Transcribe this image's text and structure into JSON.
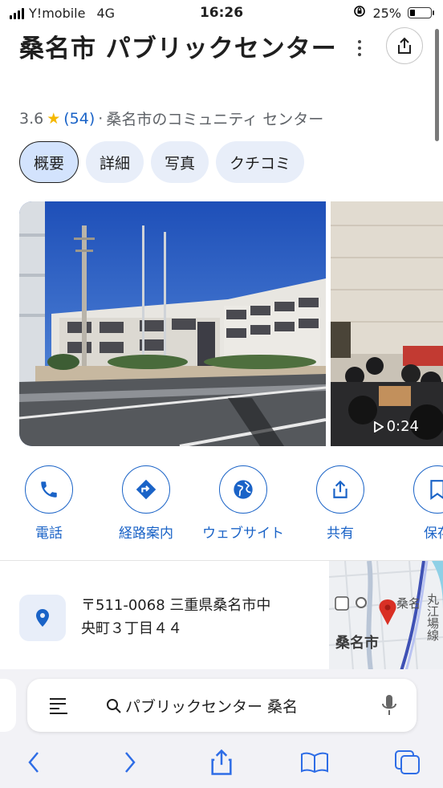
{
  "status_bar": {
    "carrier": "Y!mobile",
    "network": "4G",
    "time": "16:26",
    "battery": "25%",
    "battery_level": 0.25
  },
  "place": {
    "name": "桑名市 パブリックセンター",
    "rating": "3.6",
    "reviews": "(54)",
    "separator": "·",
    "category": "桑名市のコミュニティ センター"
  },
  "tabs": [
    {
      "label": "概要",
      "active": true
    },
    {
      "label": "詳細",
      "active": false
    },
    {
      "label": "写真",
      "active": false
    },
    {
      "label": "クチコミ",
      "active": false
    }
  ],
  "video": {
    "duration": "0:24"
  },
  "actions": [
    {
      "label": "電話",
      "icon": "phone-icon"
    },
    {
      "label": "経路案内",
      "icon": "directions-icon"
    },
    {
      "label": "ウェブサイト",
      "icon": "globe-icon"
    },
    {
      "label": "共有",
      "icon": "share-icon"
    },
    {
      "label": "保存",
      "icon": "bookmark-icon"
    }
  ],
  "address": {
    "line1": "〒511-0068 三重県桑名市中",
    "line2": "央町３丁目４４"
  },
  "map": {
    "city_label": "桑名市",
    "station_label": "桑名",
    "road_label": "丸江場線"
  },
  "browser": {
    "search_query": "パブリックセンター 桑名"
  },
  "colors": {
    "accent": "#1a63c7",
    "chip_bg": "#e8eef9",
    "star": "#f5b800",
    "pin": "#d93025"
  }
}
